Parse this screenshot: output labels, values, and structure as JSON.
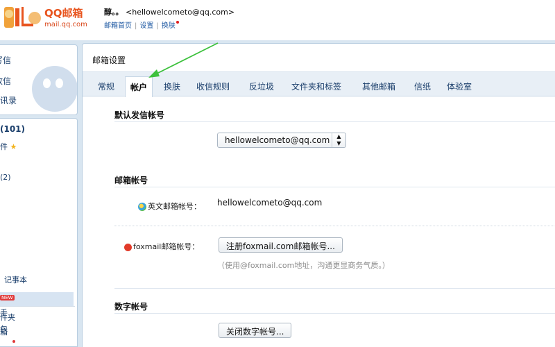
{
  "header": {
    "logo_text": "QQ邮箱",
    "logo_domain": "mail.qq.com",
    "user_name": "醇。。",
    "user_email": "<hellowelcometo@qq.com>",
    "links": [
      "邮箱首页",
      "设置",
      "换肤"
    ]
  },
  "sidebar": {
    "top_items": [
      "写信",
      "收信",
      "通讯录"
    ],
    "list": [
      {
        "label": "(101)",
        "bold": true
      },
      {
        "label": "件"
      },
      {
        "label": "(2)"
      },
      {
        "label": "件夹"
      },
      {
        "label": "箱"
      },
      {
        "label": "记事本"
      },
      {
        "label": "手"
      },
      {
        "label": "包"
      }
    ],
    "new_badge": "NEW"
  },
  "main": {
    "title": "邮箱设置",
    "tabs": [
      "常规",
      "帐户",
      "换肤",
      "收信规则",
      "反垃圾",
      "文件夹和标签",
      "其他邮箱",
      "信纸",
      "体验室"
    ],
    "active_tab": "帐户",
    "sections": {
      "default_sender": {
        "title": "默认发信帐号",
        "selected": "hellowelcometo@qq.com"
      },
      "mail_account": {
        "title": "邮箱帐号",
        "english_label": "英文邮箱帐号：",
        "english_value": "hellowelcometo@qq.com",
        "foxmail_label": "foxmail邮箱帐号：",
        "foxmail_button": "注册foxmail.com邮箱帐号...",
        "foxmail_hint": "（使用@foxmail.com地址，沟通更显商务气质。）"
      },
      "digital_account": {
        "title": "数字帐号",
        "button": "关闭数字帐号..."
      }
    }
  },
  "colors": {
    "accent_link": "#1f5aa3",
    "brand_orange": "#e8541e",
    "annotation_arrow": "#3cc13c"
  }
}
